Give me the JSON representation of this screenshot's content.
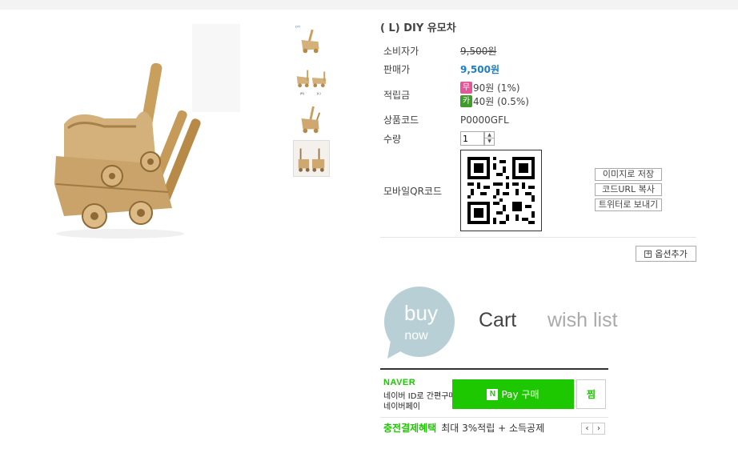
{
  "product": {
    "title": "( L) DIY 유모차",
    "image_alt": "wooden stroller"
  },
  "thumbnails": [
    {
      "name": "thumb-1",
      "caption": "stroller side view",
      "mini_label": "DIY"
    },
    {
      "name": "thumb-2",
      "caption": "two stroller sizes",
      "mini_labels": [
        "(R)",
        "(L)"
      ]
    },
    {
      "name": "thumb-3",
      "caption": "stroller front view"
    },
    {
      "name": "thumb-4",
      "caption": "stroller pair"
    }
  ],
  "spec": {
    "consumer_price_label": "소비자가",
    "consumer_price": "9,500원",
    "sale_price_label": "판매가",
    "sale_price": "9,500원",
    "points_label": "적립금",
    "points": [
      {
        "badge": "무",
        "badge_color": "#e5559a",
        "text": "90원 (1%)"
      },
      {
        "badge": "카",
        "badge_color": "#3e9d28",
        "text": "40원 (0.5%)"
      }
    ],
    "code_label": "상품코드",
    "code": "P0000GFL",
    "qty_label": "수량",
    "qty_value": "1",
    "qr_label": "모바일QR코드"
  },
  "qr_buttons": {
    "save_image": "이미지로 저장",
    "copy_url": "코드URL 복사",
    "send_twitter": "트위터로 보내기"
  },
  "option_add": "옵션추가",
  "actions": {
    "buy_top": "buy",
    "buy_bottom": "now",
    "cart": "Cart",
    "wish": "wish list"
  },
  "npay": {
    "brand": "NAVER",
    "desc1": "네이버 ID로 간편구매",
    "desc2": "네이버페이",
    "n_mark": "N",
    "pay_label": "Pay 구매",
    "jjim": "찜"
  },
  "benefit": {
    "title": "충전결제혜택",
    "text": "최대 3%적립 + 소득공제"
  },
  "colors": {
    "sale_price": "#1c7fc3",
    "naver_green": "#1ec800",
    "buy_circle": "#b8cfd6"
  }
}
